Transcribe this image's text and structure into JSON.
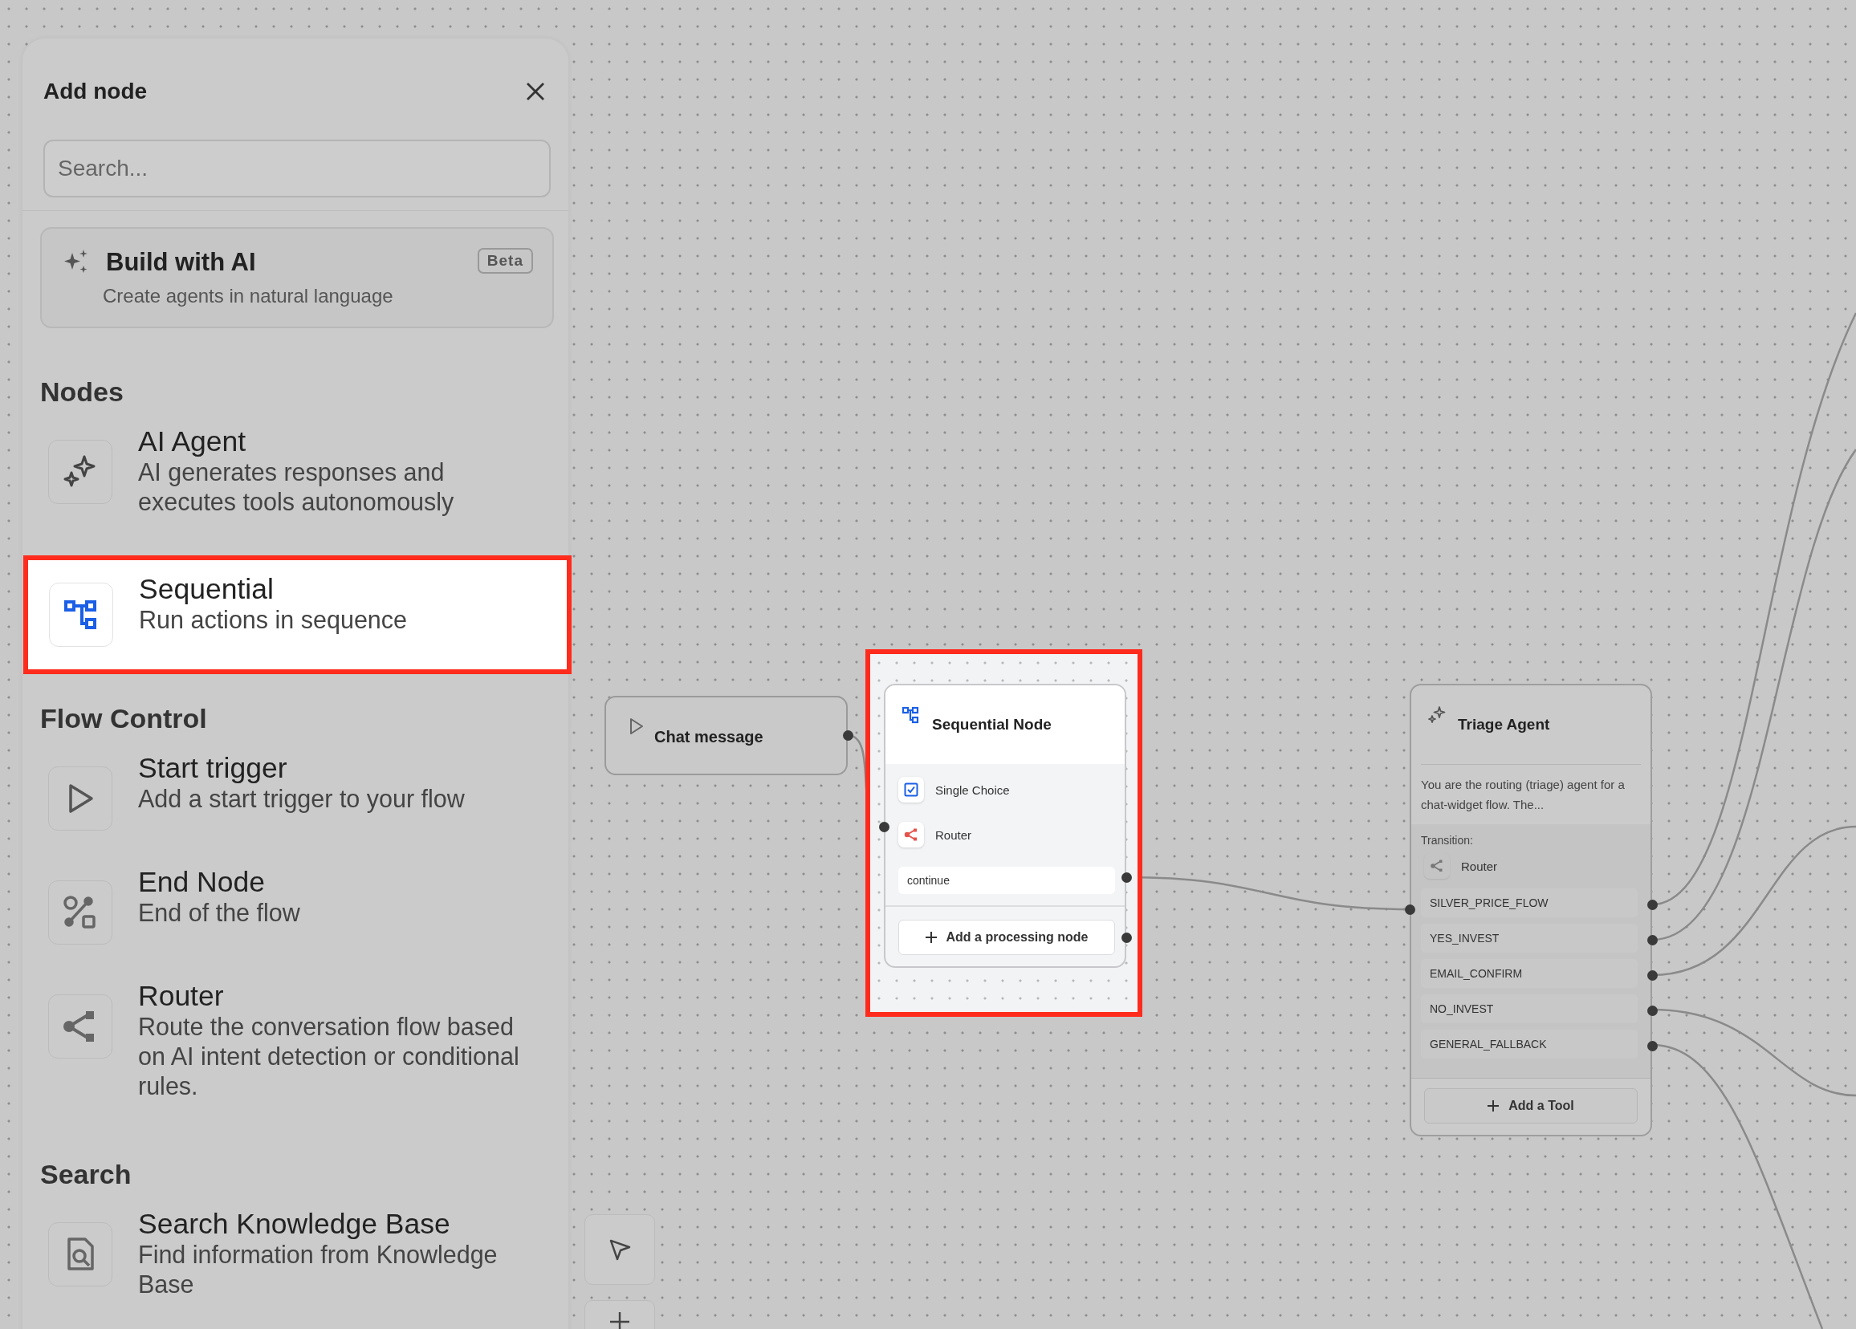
{
  "panel": {
    "title": "Add node",
    "search": {
      "placeholder": "Search..."
    },
    "build_ai": {
      "title": "Build with AI",
      "subtitle": "Create agents in natural language",
      "badge": "Beta"
    },
    "sections": [
      {
        "heading": "Nodes",
        "items": [
          {
            "kind": "agent",
            "title": "AI Agent",
            "description": "AI generates responses and executes tools autonomously",
            "selected": false
          },
          {
            "kind": "sequential",
            "title": "Sequential",
            "description": "Run actions in sequence",
            "selected": true
          }
        ]
      },
      {
        "heading": "Flow Control",
        "items": [
          {
            "kind": "start",
            "title": "Start trigger",
            "description": "Add a start trigger to your flow",
            "selected": false
          },
          {
            "kind": "end",
            "title": "End Node",
            "description": "End of the flow",
            "selected": false
          },
          {
            "kind": "router",
            "title": "Router",
            "description": "Route the conversation flow based on AI intent detection or conditional rules.",
            "selected": false
          }
        ]
      },
      {
        "heading": "Search",
        "items": [
          {
            "kind": "search",
            "title": "Search Knowledge Base",
            "description": "Find information from Knowledge Base",
            "selected": false
          }
        ]
      }
    ]
  },
  "canvas": {
    "chat_message": {
      "label": "Chat message"
    },
    "sequential_node": {
      "title": "Sequential Node",
      "highlighted": true,
      "steps": [
        {
          "kind": "single_choice",
          "label": "Single Choice"
        },
        {
          "kind": "router",
          "label": "Router"
        }
      ],
      "output": "continue",
      "add_button": "Add a processing node"
    },
    "triage_agent": {
      "title": "Triage Agent",
      "description": "You are the routing (triage) agent for a chat-widget flow. The...",
      "transition_label": "Transition:",
      "router_label": "Router",
      "routes": [
        "SILVER_PRICE_FLOW",
        "YES_INVEST",
        "EMAIL_CONFIRM",
        "NO_INVEST",
        "GENERAL_FALLBACK"
      ],
      "add_button": "Add a Tool"
    }
  }
}
